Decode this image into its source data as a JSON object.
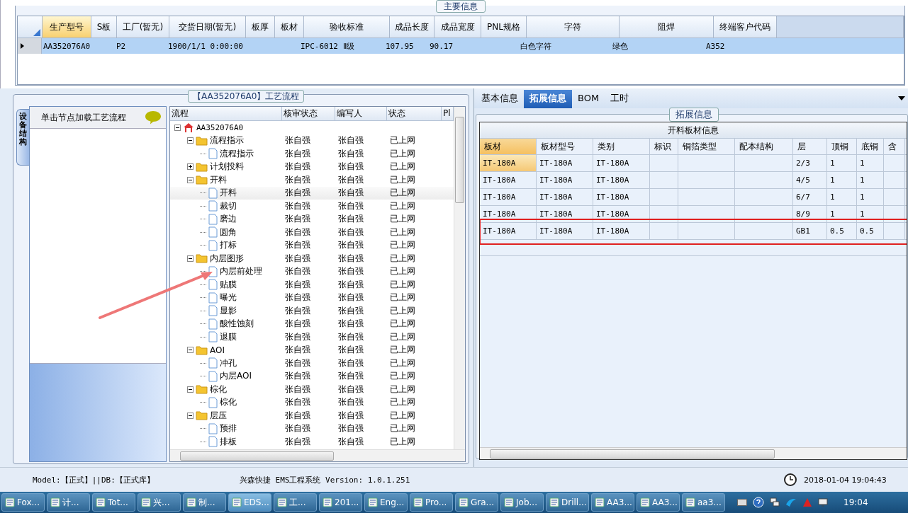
{
  "main_info": {
    "title": "主要信息",
    "columns": [
      "生产型号",
      "S板",
      "工厂(暂无)",
      "交货日期(暂无)",
      "板厚",
      "板材",
      "验收标准",
      "成品长度",
      "成品宽度",
      "PNL规格",
      "字符",
      "阻焊",
      "终端客户代码"
    ],
    "rows": [
      {
        "selected": true,
        "cells": [
          "AA352076A0",
          "",
          "P2",
          "1900/1/1 0:00:00",
          "",
          "",
          "IPC-6012 Ⅱ级",
          "107.95",
          "90.17",
          "",
          "白色字符",
          "绿色",
          "A352"
        ]
      }
    ]
  },
  "side_tab": {
    "label": "设备结构",
    "selected": true
  },
  "side_panel": {
    "hint": "单击节点加载工艺流程"
  },
  "flow": {
    "title": "【AA352076A0】工艺流程",
    "columns": [
      "流程",
      "核审状态",
      "编写人",
      "状态",
      "Pl"
    ],
    "tree": [
      {
        "label": "AA352076A0",
        "kind": "root",
        "expanded": true,
        "selected": false,
        "children": [
          {
            "label": "流程指示",
            "kind": "folder",
            "expanded": true,
            "selected": false,
            "reviewer": "张自强",
            "writer": "张自强",
            "status": "已上网",
            "children": [
              {
                "label": "流程指示",
                "kind": "step",
                "selected": false,
                "reviewer": "张自强",
                "writer": "张自强",
                "status": "已上网"
              }
            ]
          },
          {
            "label": "计划投料",
            "kind": "folder",
            "expanded": false,
            "selected": false,
            "reviewer": "张自强",
            "writer": "张自强",
            "status": "已上网"
          },
          {
            "label": "开料",
            "kind": "folder",
            "expanded": true,
            "selected": false,
            "reviewer": "张自强",
            "writer": "张自强",
            "status": "已上网",
            "children": [
              {
                "label": "开料",
                "kind": "step",
                "selected": true,
                "reviewer": "张自强",
                "writer": "张自强",
                "status": "已上网"
              },
              {
                "label": "裁切",
                "kind": "step",
                "selected": false,
                "reviewer": "张自强",
                "writer": "张自强",
                "status": "已上网"
              },
              {
                "label": "磨边",
                "kind": "step",
                "selected": false,
                "reviewer": "张自强",
                "writer": "张自强",
                "status": "已上网"
              },
              {
                "label": "圆角",
                "kind": "step",
                "selected": false,
                "reviewer": "张自强",
                "writer": "张自强",
                "status": "已上网"
              },
              {
                "label": "打标",
                "kind": "step",
                "selected": false,
                "reviewer": "张自强",
                "writer": "张自强",
                "status": "已上网"
              }
            ]
          },
          {
            "label": "内层图形",
            "kind": "folder",
            "expanded": true,
            "selected": false,
            "reviewer": "张自强",
            "writer": "张自强",
            "status": "已上网",
            "children": [
              {
                "label": "内层前处理",
                "kind": "step",
                "selected": false,
                "reviewer": "张自强",
                "writer": "张自强",
                "status": "已上网"
              },
              {
                "label": "贴膜",
                "kind": "step",
                "selected": false,
                "reviewer": "张自强",
                "writer": "张自强",
                "status": "已上网"
              },
              {
                "label": "曝光",
                "kind": "step",
                "selected": false,
                "reviewer": "张自强",
                "writer": "张自强",
                "status": "已上网"
              },
              {
                "label": "显影",
                "kind": "step",
                "selected": false,
                "reviewer": "张自强",
                "writer": "张自强",
                "status": "已上网"
              },
              {
                "label": "酸性蚀刻",
                "kind": "step",
                "selected": false,
                "reviewer": "张自强",
                "writer": "张自强",
                "status": "已上网"
              },
              {
                "label": "退膜",
                "kind": "step",
                "selected": false,
                "reviewer": "张自强",
                "writer": "张自强",
                "status": "已上网"
              }
            ]
          },
          {
            "label": "AOI",
            "kind": "folder",
            "expanded": true,
            "selected": false,
            "reviewer": "张自强",
            "writer": "张自强",
            "status": "已上网",
            "children": [
              {
                "label": "冲孔",
                "kind": "step",
                "selected": false,
                "reviewer": "张自强",
                "writer": "张自强",
                "status": "已上网"
              },
              {
                "label": "内层AOI",
                "kind": "step",
                "selected": false,
                "reviewer": "张自强",
                "writer": "张自强",
                "status": "已上网"
              }
            ]
          },
          {
            "label": "棕化",
            "kind": "folder",
            "expanded": true,
            "selected": false,
            "reviewer": "张自强",
            "writer": "张自强",
            "status": "已上网",
            "children": [
              {
                "label": "棕化",
                "kind": "step",
                "selected": false,
                "reviewer": "张自强",
                "writer": "张自强",
                "status": "已上网"
              }
            ]
          },
          {
            "label": "层压",
            "kind": "folder",
            "expanded": true,
            "selected": false,
            "reviewer": "张自强",
            "writer": "张自强",
            "status": "已上网",
            "children": [
              {
                "label": "预排",
                "kind": "step",
                "selected": false,
                "reviewer": "张自强",
                "writer": "张自强",
                "status": "已上网"
              },
              {
                "label": "排板",
                "kind": "step",
                "selected": false,
                "reviewer": "张自强",
                "writer": "张自强",
                "status": "已上网"
              }
            ]
          }
        ]
      }
    ]
  },
  "detail_tabs": [
    {
      "label": "基本信息",
      "selected": false
    },
    {
      "label": "拓展信息",
      "selected": true
    },
    {
      "label": "BOM",
      "selected": false
    },
    {
      "label": "工时",
      "selected": false
    }
  ],
  "extended": {
    "title": "拓展信息",
    "caption": "开料板材信息",
    "columns": [
      "板材",
      "板材型号",
      "类别",
      "标识",
      "铜箔类型",
      "配本结构",
      "层",
      "顶铜",
      "底铜",
      "含"
    ],
    "rows": [
      {
        "cells": [
          "IT-180A",
          "IT-180A",
          "IT-180A",
          "",
          "",
          "",
          "2/3",
          "1",
          "1",
          ""
        ],
        "highlighted": false
      },
      {
        "cells": [
          "IT-180A",
          "IT-180A",
          "IT-180A",
          "",
          "",
          "",
          "4/5",
          "1",
          "1",
          ""
        ],
        "highlighted": false
      },
      {
        "cells": [
          "IT-180A",
          "IT-180A",
          "IT-180A",
          "",
          "",
          "",
          "6/7",
          "1",
          "1",
          ""
        ],
        "highlighted": false
      },
      {
        "cells": [
          "IT-180A",
          "IT-180A",
          "IT-180A",
          "",
          "",
          "",
          "8/9",
          "1",
          "1",
          ""
        ],
        "highlighted": false
      },
      {
        "cells": [
          "IT-180A",
          "IT-180A",
          "IT-180A",
          "",
          "",
          "",
          "GB1",
          "0.5",
          "0.5",
          ""
        ],
        "highlighted": true
      }
    ]
  },
  "status_bar": {
    "mode": "Model:【正式】||DB:【正式库】",
    "product": "兴森快捷 EMS工程系统 Version: 1.0.1.251",
    "datetime": "2018-01-04 19:04:43"
  },
  "taskbar": {
    "items": [
      {
        "label": "Fox...",
        "selected": false
      },
      {
        "label": "计...",
        "selected": false
      },
      {
        "label": "Tot...",
        "selected": false
      },
      {
        "label": "兴...",
        "selected": false
      },
      {
        "label": "制...",
        "selected": false
      },
      {
        "label": "EDS...",
        "selected": true
      },
      {
        "label": "工...",
        "selected": false
      },
      {
        "label": "201...",
        "selected": false
      },
      {
        "label": "Eng...",
        "selected": false
      },
      {
        "label": "Pro...",
        "selected": false
      },
      {
        "label": "Gra...",
        "selected": false
      },
      {
        "label": "Job...",
        "selected": false
      },
      {
        "label": "Drill...",
        "selected": false
      },
      {
        "label": "AA3...",
        "selected": false
      },
      {
        "label": "AA3...",
        "selected": false
      },
      {
        "label": "aa3...",
        "selected": false
      }
    ],
    "clock": "19:04"
  }
}
